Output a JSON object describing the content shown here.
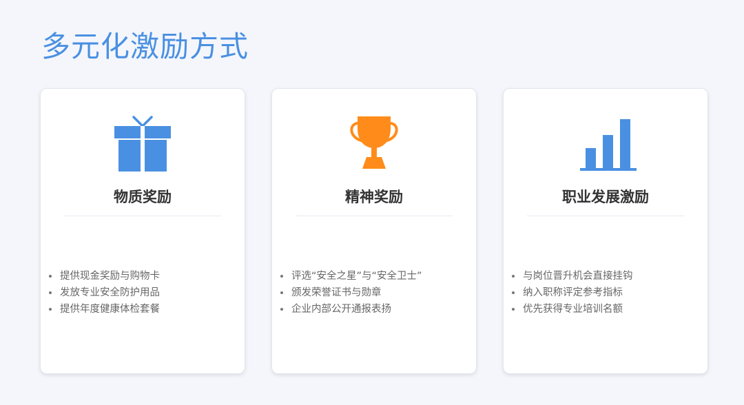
{
  "page": {
    "title": "多元化激励方式"
  },
  "colors": {
    "title": "#4a90e2",
    "blue_icon": "#4a90e2",
    "orange_icon": "#ff8c1a",
    "card_title": "#333333",
    "list_text": "#666666"
  },
  "cards": [
    {
      "icon": "gift-icon",
      "title": "物质奖励",
      "items": [
        "提供现金奖励与购物卡",
        "发放专业安全防护用品",
        "提供年度健康体检套餐"
      ]
    },
    {
      "icon": "trophy-icon",
      "title": "精神奖励",
      "items": [
        "评选“安全之星”与“安全卫士”",
        "颁发荣誉证书与勋章",
        "企业内部公开通报表扬"
      ]
    },
    {
      "icon": "bar-chart-icon",
      "title": "职业发展激励",
      "items": [
        "与岗位晋升机会直接挂钩",
        "纳入职称评定参考指标",
        "优先获得专业培训名额"
      ]
    }
  ]
}
